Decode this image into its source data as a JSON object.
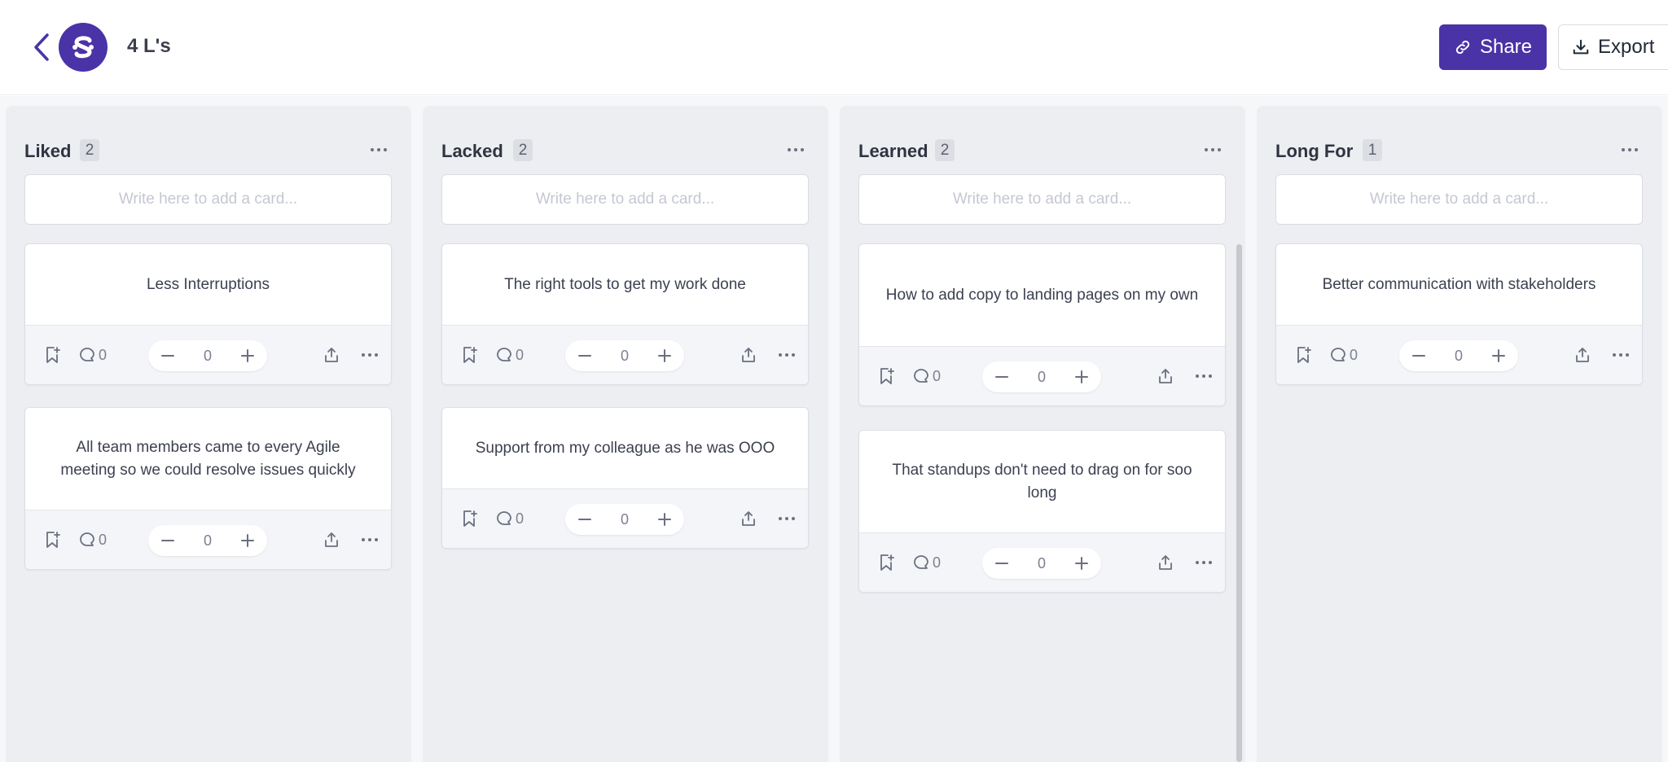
{
  "header": {
    "title": "4 L's",
    "share_label": "Share",
    "export_label": "Export"
  },
  "colors": {
    "brand": "#4a33a6",
    "column_bg": "#edeef2",
    "card_bg": "#ffffff"
  },
  "add_card_placeholder": "Write here to add a card...",
  "columns": [
    {
      "title": "Liked",
      "count": "2",
      "cards": [
        {
          "text": "Less Interruptions",
          "comments": "0",
          "votes": "0"
        },
        {
          "text": "All team members came to every Agile meeting so we could resolve issues quickly",
          "comments": "0",
          "votes": "0"
        }
      ]
    },
    {
      "title": "Lacked",
      "count": "2",
      "cards": [
        {
          "text": "The right tools to get my work done",
          "comments": "0",
          "votes": "0"
        },
        {
          "text": "Support from my colleague as he was OOO",
          "comments": "0",
          "votes": "0"
        }
      ]
    },
    {
      "title": "Learned",
      "count": "2",
      "cards": [
        {
          "text": "How to add copy to landing pages on my own",
          "comments": "0",
          "votes": "0"
        },
        {
          "text": "That standups don't need to drag on for soo long",
          "comments": "0",
          "votes": "0"
        }
      ]
    },
    {
      "title": "Long For",
      "count": "1",
      "cards": [
        {
          "text": "Better communication with stakeholders",
          "comments": "0",
          "votes": "0"
        }
      ]
    }
  ]
}
